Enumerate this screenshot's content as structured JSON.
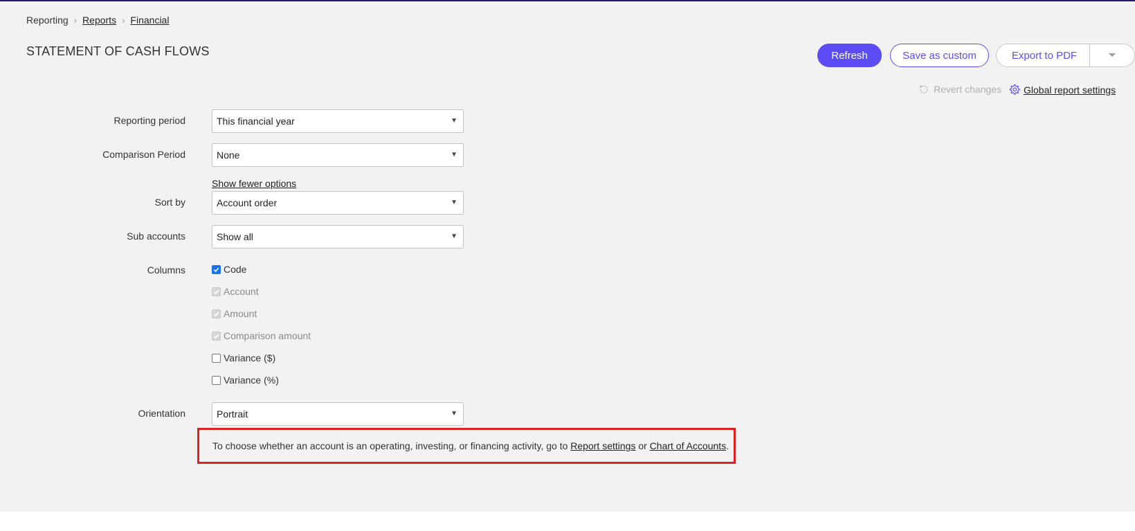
{
  "breadcrumb": {
    "items": [
      "Reporting",
      "Reports",
      "Financial"
    ]
  },
  "page": {
    "title": "STATEMENT OF CASH FLOWS"
  },
  "toolbar": {
    "refresh_label": "Refresh",
    "save_custom_label": "Save as custom",
    "export_label": "Export to PDF",
    "revert_label": "Revert changes",
    "global_settings_label": "Global report settings"
  },
  "form": {
    "reporting_period": {
      "label": "Reporting period",
      "value": "This financial year"
    },
    "comparison_period": {
      "label": "Comparison Period",
      "value": "None"
    },
    "show_fewer_label": "Show fewer options",
    "sort_by": {
      "label": "Sort by",
      "value": "Account order"
    },
    "sub_accounts": {
      "label": "Sub accounts",
      "value": "Show all"
    },
    "columns": {
      "label": "Columns",
      "items": [
        {
          "label": "Code",
          "checked": true,
          "disabled": false
        },
        {
          "label": "Account",
          "checked": true,
          "disabled": true
        },
        {
          "label": "Amount",
          "checked": true,
          "disabled": true
        },
        {
          "label": "Comparison amount",
          "checked": true,
          "disabled": true
        },
        {
          "label": "Variance ($)",
          "checked": false,
          "disabled": false
        },
        {
          "label": "Variance (%)",
          "checked": false,
          "disabled": false
        }
      ]
    },
    "orientation": {
      "label": "Orientation",
      "value": "Portrait"
    }
  },
  "notice": {
    "text_before": "To choose whether an account is an operating, investing, or financing activity, go to ",
    "link1": "Report settings",
    "text_middle": " or ",
    "link2": "Chart of Accounts",
    "text_after": "."
  },
  "colors": {
    "accent": "#5b4cf5",
    "top_bar": "#1f1a6b",
    "highlight_border": "#dd2020",
    "checkbox_checked": "#1a73e8"
  },
  "icons": {
    "breadcrumb_separator": "chevron-right-icon",
    "select_caret": "caret-down-icon",
    "export_dropdown": "chevron-down-icon",
    "revert": "revert-icon",
    "global_settings": "gear-icon",
    "checkbox_checked": "check-icon"
  }
}
